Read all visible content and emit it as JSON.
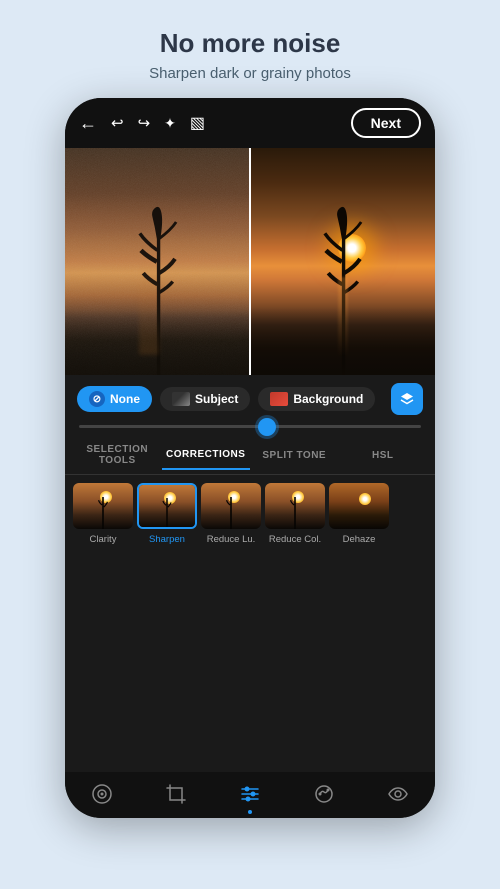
{
  "header": {
    "title": "No more noise",
    "subtitle": "Sharpen dark or grainy photos"
  },
  "toolbar": {
    "next_label": "Next"
  },
  "selection": {
    "none_label": "None",
    "subject_label": "Subject",
    "background_label": "Background"
  },
  "tabs": [
    {
      "id": "selection_tools",
      "label": "SELECTION TOOLS",
      "active": false
    },
    {
      "id": "corrections",
      "label": "CORRECTIONS",
      "active": true
    },
    {
      "id": "split_tone",
      "label": "SPLIT TONE",
      "active": false
    },
    {
      "id": "hsl",
      "label": "HSL",
      "active": false
    }
  ],
  "corrections": [
    {
      "id": "clarity",
      "label": "Clarity",
      "active": false
    },
    {
      "id": "sharpen",
      "label": "Sharpen",
      "active": true
    },
    {
      "id": "reduce_lu",
      "label": "Reduce Lu.",
      "active": false
    },
    {
      "id": "reduce_col",
      "label": "Reduce Col.",
      "active": false
    },
    {
      "id": "dehaze",
      "label": "Dehaze",
      "active": false
    }
  ],
  "nav": [
    {
      "id": "camera",
      "icon": "◎",
      "active": false
    },
    {
      "id": "crop",
      "icon": "⊡",
      "active": false
    },
    {
      "id": "adjust",
      "icon": "⚌",
      "active": true
    },
    {
      "id": "healing",
      "icon": "✦",
      "active": false
    },
    {
      "id": "eye",
      "icon": "👁",
      "active": false
    }
  ],
  "icons": {
    "back": "←",
    "undo": "↩",
    "redo": "↪",
    "magic": "✦",
    "compare": "▧",
    "no_sign": "⊘",
    "layers": "⊕"
  }
}
